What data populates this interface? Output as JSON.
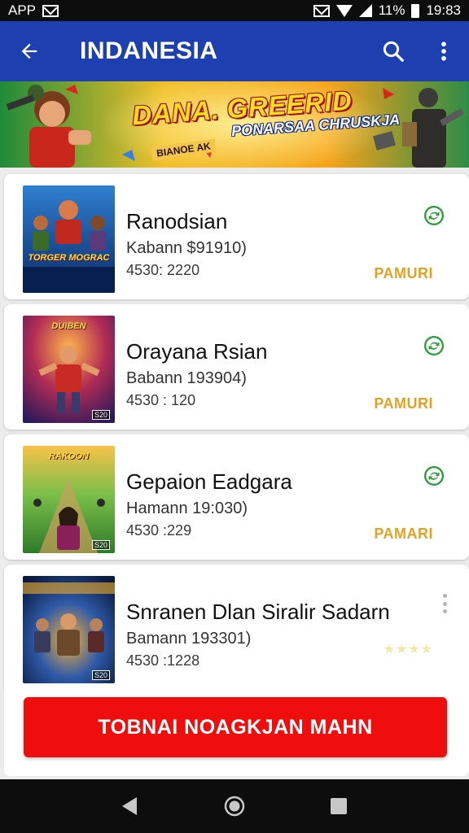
{
  "status_bar": {
    "carrier": "APP",
    "battery": "11%",
    "time": "19:83"
  },
  "app_bar": {
    "title": "INDANESIA",
    "back_icon": "arrow-left-icon",
    "search_icon": "search-icon",
    "menu_icon": "more-vertical-icon"
  },
  "banner": {
    "title": "DANA. GREERID",
    "subtitle": "PONARSAA CHRUSKJA",
    "tag": "BIANOE AK"
  },
  "games": [
    {
      "title": "Ranodsian",
      "meta": "Kabann $91910)",
      "stats": "4530: 2220",
      "action": "PAMURI",
      "thumb_caption": "TORGER MOGRAC",
      "status_icon": "sync-icon"
    },
    {
      "title": "Orayana Rsian",
      "meta": "Babann 193904)",
      "stats": "4530 : 120",
      "action": "PAMURI",
      "thumb_caption": "DUIBEN",
      "thumb_badge": "S20",
      "status_icon": "sync-icon"
    },
    {
      "title": "Gepaion Eadgara",
      "meta": "Hamann 19:030)",
      "stats": "4530 :229",
      "action": "PAMARI",
      "thumb_caption": "RAKOON",
      "thumb_badge": "S20",
      "status_icon": "sync-icon"
    },
    {
      "title": "Snranen Dlan Siralir Sadarn",
      "meta": "Bamann 193301)",
      "stats": "4530 :1228",
      "rating": 4,
      "thumb_badge": "S20",
      "status_icon": "more-vertical-icon"
    }
  ],
  "cta": {
    "label": "TOBNAI NOAGKJAN MAHN"
  },
  "nav": {
    "back_icon": "nav-back-icon",
    "home_icon": "nav-home-icon",
    "recents_icon": "nav-recents-icon"
  },
  "colors": {
    "app_bar": "#1e3fb0",
    "action_text": "#e3a224",
    "status_green": "#2e9e3e",
    "cta_red": "#f00d0d"
  }
}
